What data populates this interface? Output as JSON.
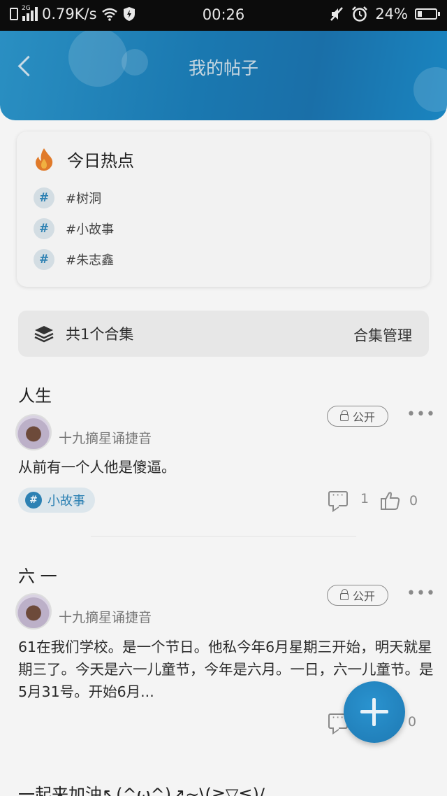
{
  "status_bar": {
    "network": "2G",
    "speed": "0.79K/s",
    "time": "00:26",
    "battery": "24%",
    "battery_level": 0.24
  },
  "header": {
    "title": "我的帖子"
  },
  "hot_topics": {
    "title": "今日热点",
    "items": [
      "#树洞",
      "#小故事",
      "#朱志鑫"
    ]
  },
  "collection": {
    "summary": "共1个合集",
    "manage_label": "合集管理"
  },
  "posts": [
    {
      "title": "人生",
      "author": "十九摘星诵捷音",
      "visibility": "公开",
      "more": "•••",
      "body": "从前有一个人他是傻逼。",
      "tag": "小故事",
      "comments": "1",
      "likes": "0"
    },
    {
      "title": "六 一",
      "author": "十九摘星诵捷音",
      "visibility": "公开",
      "more": "•••",
      "body": "61在我们学校。是一个节日。他私今年6月星期三开始，明天就星期三了。今天是六一儿童节，今年是六月。一日，六一儿童节。是5月31号。开始6月...",
      "likes": "0"
    }
  ],
  "next_post_title": "一起来加油↖(^ω^)↗~\\(≧▽≦)/",
  "colors": {
    "accent": "#2d81b3",
    "header": "#1a78b0",
    "background": "#f4f4f4"
  }
}
